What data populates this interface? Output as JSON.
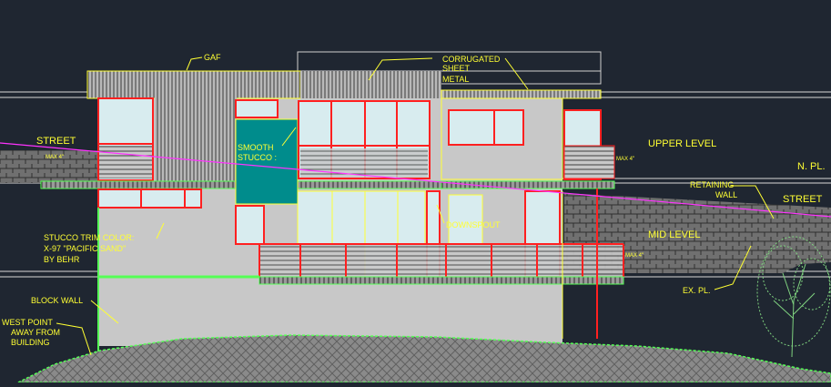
{
  "colors": {
    "background": "#1f2631",
    "annotation": "#ffff33",
    "wall": "#c8c8c8",
    "window_frame": "#ff2020",
    "glass": "#d8ecef",
    "stucco_panel": "#008c8c",
    "railing": "#ff2020",
    "grade_line": "#ff33ff",
    "ground_fill": "#8a8a8a",
    "vegetation": "#7fd27f"
  },
  "labels": {
    "gaf": "GAF",
    "corrugated_line1": "CORRUGATED",
    "corrugated_line2": "SHEET",
    "corrugated_line3": "METAL",
    "street_left": "STREET",
    "street_right": "STREET",
    "smooth_stucco_line1": "SMOOTH",
    "smooth_stucco_line2": "STUCCO :",
    "upper_level": "UPPER LEVEL",
    "mid_level": "MID LEVEL",
    "np": "N. PL.",
    "retaining_wall_line1": "RETAINING",
    "retaining_wall_line2": "WALL",
    "downspout": "DOWNSPOUT",
    "stucco_trim_line1": "STUCCO TRIM COLOR:",
    "stucco_trim_line2": "X-97 \"PACIFIC SAND\"",
    "stucco_trim_line3": "BY BEHR",
    "block_wall": "BLOCK WALL",
    "west_point_line1": "WEST POINT",
    "west_point_line2": "AWAY FROM",
    "west_point_line3": "BUILDING",
    "ex_pl": "EX. PL.",
    "max4_left": "MAX 4\"",
    "max4_upper": "MAX 4\"",
    "max4_mid": "MAX 4\""
  }
}
